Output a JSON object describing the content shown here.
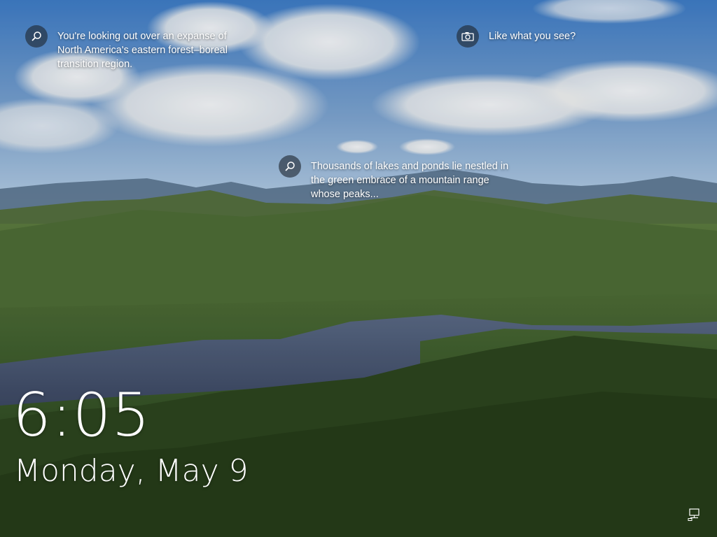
{
  "lock_screen": {
    "time": "6:05",
    "date": "Monday, May 9",
    "spotlight": {
      "hotspots": [
        {
          "icon": "search-icon",
          "text": "You're looking out over an expanse of North America's eastern forest–boreal transition region."
        },
        {
          "icon": "camera-icon",
          "text": "Like what you see?"
        },
        {
          "icon": "search-icon",
          "text": "Thousands of lakes and ponds lie nestled in the green embrace of a mountain range whose peaks..."
        }
      ]
    },
    "status_icons": [
      {
        "icon": "network-icon"
      }
    ]
  },
  "colors": {
    "sky_top": "#3f7ec9",
    "sky_horizon": "#bcd4ea",
    "forest": "#3b5a2b",
    "lake": "#45526c",
    "text": "#ffffff"
  }
}
